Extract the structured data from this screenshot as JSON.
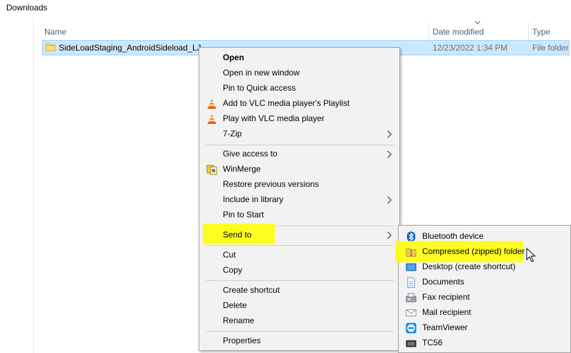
{
  "window": {
    "title": "Downloads"
  },
  "columns": {
    "name": "Name",
    "date_modified": "Date modified",
    "type": "Type"
  },
  "file_row": {
    "name": "SideLoadStaging_AndroidSideload_LJ",
    "date_modified": "12/23/2022 1:34 PM",
    "type": "File folder"
  },
  "context_menu": {
    "open": "Open",
    "open_new_window": "Open in new window",
    "pin_quick_access": "Pin to Quick access",
    "vlc_add_playlist": "Add to VLC media player's Playlist",
    "vlc_play": "Play with VLC media player",
    "seven_zip": "7-Zip",
    "give_access": "Give access to",
    "winmerge": "WinMerge",
    "restore_versions": "Restore previous versions",
    "include_library": "Include in library",
    "pin_start": "Pin to Start",
    "send_to": "Send to",
    "cut": "Cut",
    "copy": "Copy",
    "create_shortcut": "Create shortcut",
    "delete": "Delete",
    "rename": "Rename",
    "properties": "Properties"
  },
  "send_to_menu": {
    "bluetooth": "Bluetooth device",
    "compressed": "Compressed (zipped) folder",
    "desktop": "Desktop (create shortcut)",
    "documents": "Documents",
    "fax": "Fax recipient",
    "mail": "Mail recipient",
    "teamviewer": "TeamViewer",
    "tc56": "TC56"
  },
  "colors": {
    "selection_bg": "#cce8ff",
    "highlight": "#ffff00",
    "menu_bg": "#f2f2f2",
    "header_text": "#4c607a"
  }
}
